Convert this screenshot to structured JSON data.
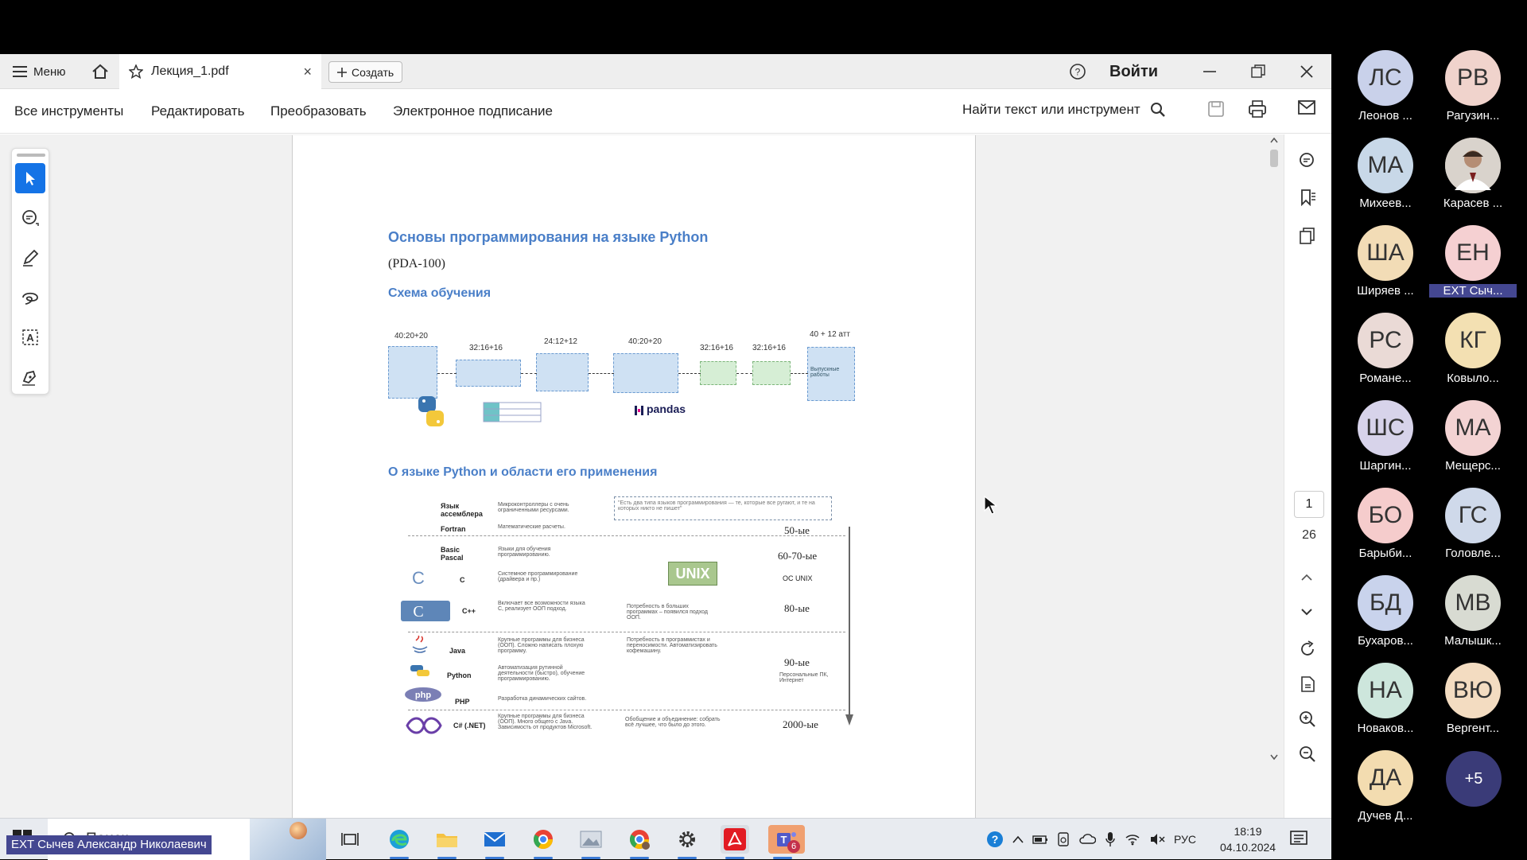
{
  "app": {
    "menu_label": "Меню",
    "tab_title": "Лекция_1.pdf",
    "tab_close": "×",
    "create_label": "Создать",
    "signin_label": "Войти"
  },
  "toolbar": {
    "all_tools": "Все инструменты",
    "edit": "Редактировать",
    "convert": "Преобразовать",
    "esign": "Электронное подписание",
    "search_placeholder": "Найти текст или инструмент"
  },
  "document": {
    "title": "Основы программирования на языке Python",
    "code": "(PDA-100)",
    "schema_heading": "Схема обучения",
    "flow_hours": [
      "40:20+20",
      "32:16+16",
      "24:12+12",
      "40:20+20",
      "32:16+16",
      "32:16+16",
      "40 + 12 атт"
    ],
    "flow_final": "Выпускные работы",
    "pandas_label": "pandas",
    "about_heading": "О языке Python и области его применения",
    "quote": "\"Есть два типа языков программирования — те, которые все ругают, и те на которых никто не пишет\"",
    "unix_badge": "UNIX",
    "languages": [
      {
        "name": "Язык ассемблера",
        "desc": "Микроконтроллеры с очень ограниченными ресурсами."
      },
      {
        "name": "Fortran",
        "desc": "Математические расчеты."
      },
      {
        "name": "Basic Pascal",
        "desc": "Языки для обучения программированию."
      },
      {
        "name": "C",
        "desc": "Системное программирование (драйвера и пр.)"
      },
      {
        "name": "C++",
        "desc": "Включает все возможности языка С, реализует ООП подход."
      },
      {
        "name": "Java",
        "desc": "Крупные программы для бизнеса (ООП). Сложно написать плохую программу."
      },
      {
        "name": "Python",
        "desc": "Автоматизация рутинной деятельности (быстро), обучение программированию."
      },
      {
        "name": "PHP",
        "desc": "Разработка динамических сайтов."
      },
      {
        "name": "C# (.NET)",
        "desc": "Крупные программы для бизнеса (ООП). Много общего с Java. Зависимость от продуктов Microsoft."
      }
    ],
    "notes": {
      "cpp": "Потребность в больших программах – появился подход ООП.",
      "java": "Потребность в программистах и переносимости. Автоматизировать кофемашину.",
      "pc": "Персональные ПК, Интернет",
      "csharp": "Обобщение и объединение: собрать всё лучшее, что было до этого."
    },
    "eras": [
      "50-ые",
      "60-70-ые",
      "ОС UNIX",
      "80-ые",
      "90-ые",
      "2000-ые"
    ]
  },
  "pager": {
    "current": "1",
    "total": "26"
  },
  "taskbar": {
    "search_label": "Поиск",
    "lang": "РУС",
    "time": "18:19",
    "date": "04.10.2024",
    "teams_badge": "6"
  },
  "participants": [
    {
      "initials": "ЛС",
      "name": "Леонов ...",
      "color": "#c9d1ea"
    },
    {
      "initials": "РВ",
      "name": "Рагузин...",
      "color": "#f0d3cc"
    },
    {
      "initials": "МА",
      "name": "Михеев...",
      "color": "#c8d8e8"
    },
    {
      "initials": "",
      "name": "Карасев ...",
      "color": "#c4b8ac"
    },
    {
      "initials": "ША",
      "name": "Ширяев ...",
      "color": "#f2dcb6"
    },
    {
      "initials": "ЕН",
      "name": "EXT Сыч...",
      "color": "#f5d0d2"
    },
    {
      "initials": "РС",
      "name": "Романе...",
      "color": "#eadad6"
    },
    {
      "initials": "КГ",
      "name": "Ковыло...",
      "color": "#f3e0b2"
    },
    {
      "initials": "ШС",
      "name": "Шаргин...",
      "color": "#d7d3ea"
    },
    {
      "initials": "МА",
      "name": "Мещерс...",
      "color": "#f3d3d3"
    },
    {
      "initials": "БО",
      "name": "Барыби...",
      "color": "#f5cccc"
    },
    {
      "initials": "ГС",
      "name": "Головле...",
      "color": "#cfd9ea"
    },
    {
      "initials": "БД",
      "name": "Бухаров...",
      "color": "#c9d3ec"
    },
    {
      "initials": "МВ",
      "name": "Малышк...",
      "color": "#d8dbd2"
    },
    {
      "initials": "НА",
      "name": "Новаков...",
      "color": "#cde6dc"
    },
    {
      "initials": "ВЮ",
      "name": "Вергент...",
      "color": "#f3dcc1"
    },
    {
      "initials": "ДА",
      "name": "Дучев Д...",
      "color": "#f3dcb0"
    }
  ],
  "more_participants": "+5",
  "presenter": "EXT Сычев Александр Николаевич",
  "colors": {
    "accent": "#1473e6",
    "teams": "#444791",
    "doc_heading": "#4a7fc8"
  }
}
